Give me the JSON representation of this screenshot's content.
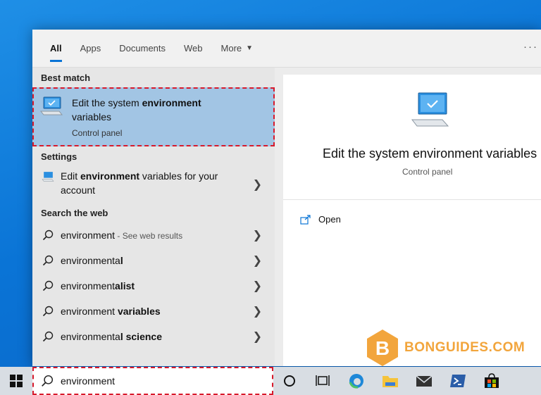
{
  "tabs": [
    {
      "label": "All",
      "active": true
    },
    {
      "label": "Apps"
    },
    {
      "label": "Documents"
    },
    {
      "label": "Web"
    },
    {
      "label": "More"
    }
  ],
  "more_menu": "···",
  "sections": {
    "best_match": "Best match",
    "settings": "Settings",
    "search_web": "Search the web"
  },
  "best_match": {
    "title_pre": "Edit the system ",
    "title_bold": "environment",
    "title_post": " variables",
    "subtitle": "Control panel"
  },
  "settings_item": {
    "pre": "Edit ",
    "bold": "environment",
    "post": " variables for your account"
  },
  "web_items": [
    {
      "pre": "environment",
      "bold": "",
      "hint": " - See web results"
    },
    {
      "pre": "environmenta",
      "bold": "l",
      "hint": ""
    },
    {
      "pre": "environment",
      "bold": "alist",
      "hint": ""
    },
    {
      "pre": "environment ",
      "bold": "variables",
      "hint": ""
    },
    {
      "pre": "environmenta",
      "bold": "l science",
      "hint": ""
    }
  ],
  "preview": {
    "title": "Edit the system environment variables",
    "subtitle": "Control panel",
    "open_label": "Open"
  },
  "search": {
    "value": "environment"
  },
  "watermark": {
    "letter": "B",
    "text": "BONGUIDES.COM"
  },
  "colors": {
    "accent": "#0a74d6",
    "highlight": "#a2c5e4",
    "annotation": "#d7192b",
    "watermark": "#f2a53c"
  }
}
